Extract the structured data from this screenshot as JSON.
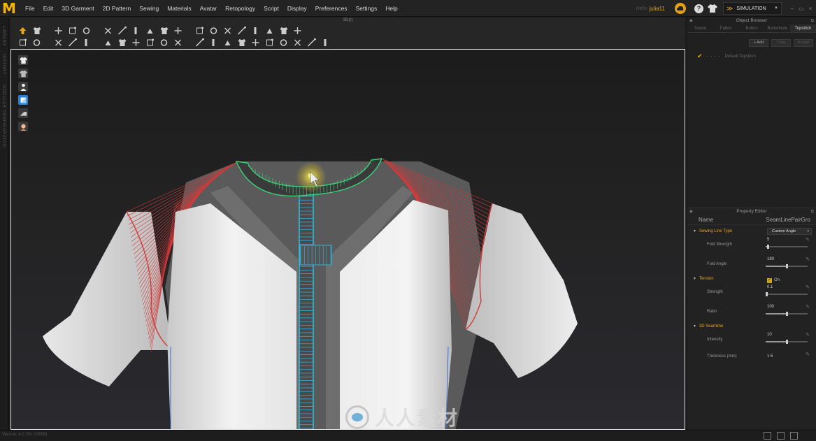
{
  "app": {
    "logo_glyph": "M",
    "menus": [
      "File",
      "Edit",
      "3D Garment",
      "2D Pattern",
      "Sewing",
      "Materials",
      "Avatar",
      "Retopology",
      "Script",
      "Display",
      "Preferences",
      "Settings",
      "Help"
    ],
    "user_label": "Hello",
    "user_name": "julia11",
    "help_glyph": "?",
    "mode_label": "SIMULATION",
    "window_controls": [
      "–",
      "▭",
      "×"
    ]
  },
  "left_tabs": [
    "LIBRARY",
    "HISTORY",
    "MODULAR CONFIGURATOR"
  ],
  "toolbar": {
    "title": "3D(r)",
    "row1_count": 19,
    "row2_count": 21
  },
  "object_browser": {
    "title": "Object Browser",
    "tabs": [
      "Scene",
      "Fabric",
      "Button",
      "Buttonhole",
      "Topstitch"
    ],
    "active_tab": "Topstitch",
    "actions": [
      "+ Add",
      "Copy",
      "Assign"
    ],
    "items": [
      {
        "name": "Default Topstitch",
        "checked": true
      }
    ]
  },
  "property_editor": {
    "title": "Property Editor",
    "name_label": "Name",
    "name_value": "SeamLinePairGro",
    "sections": {
      "sewing_line_type": {
        "label": "Sewing Line Type",
        "value": "Custom Angle"
      },
      "tension": {
        "label": "Tension",
        "value": "On"
      },
      "seamline": {
        "label": "3D Seamline"
      }
    },
    "props": {
      "fold_strength": {
        "label": "Fold Strength",
        "value": "5",
        "level": 0.05
      },
      "fold_angle": {
        "label": "Fold Angle",
        "value": "180",
        "level": 0.5
      },
      "strength": {
        "label": "Strength",
        "value": "0.1",
        "level": 0.02
      },
      "ratio": {
        "label": "Ratio",
        "value": "100",
        "level": 0.5
      },
      "intensity": {
        "label": "Intensity",
        "value": "10",
        "level": 0.5
      },
      "thickness": {
        "label": "Thickness (mm)",
        "value": "1.5"
      }
    }
  },
  "watermark": {
    "text": "人人素材"
  },
  "status": {
    "text": "Version: 4.2.261 (r3058)"
  },
  "colors": {
    "accent": "#e6a418",
    "seam_red": "#d43a3a",
    "seam_cyan": "#31b8e0",
    "seam_green": "#3bd27a",
    "viewport_border": "#e6e6e6"
  }
}
